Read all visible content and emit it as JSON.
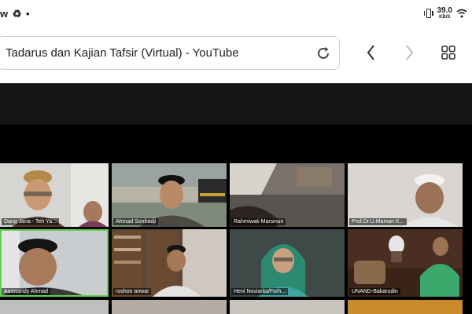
{
  "status_bar": {
    "left_icons": [
      "w",
      "♻",
      "•"
    ],
    "net_speed_value": "39.0",
    "net_speed_unit": "KB/S"
  },
  "address_bar": {
    "page_title": "Tadarus dan Kajian Tafsir (Virtual) - YouTube"
  },
  "participants": [
    {
      "name": "Dang Jana - Teh Ya..."
    },
    {
      "name": ""
    },
    {
      "name": "Ahmad Sonhadji"
    },
    {
      "name": "Rahmiwati Marsinun"
    },
    {
      "name": "Prof.Dr.U.Maman K..."
    },
    {
      "name": "Auswandy Ahmad"
    },
    {
      "name": "roshon anwar"
    },
    {
      "name": "Heni Noviarita/Forh..."
    },
    {
      "name": "UNAND-Bakarudin"
    }
  ]
}
